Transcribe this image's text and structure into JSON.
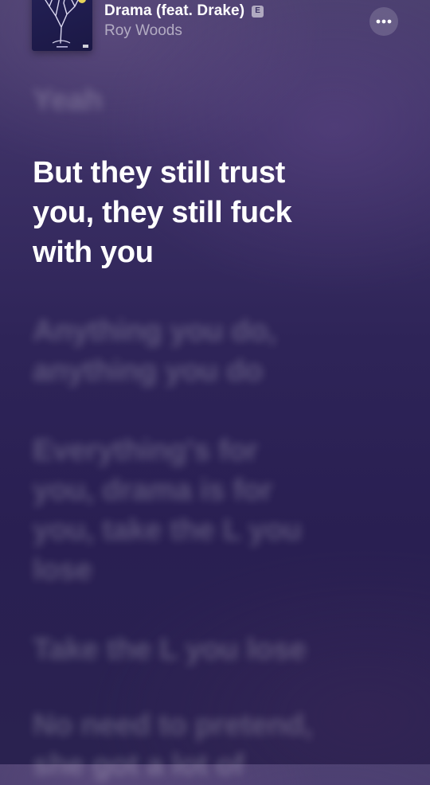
{
  "now_playing": {
    "title": "Drama (feat. Drake)",
    "explicit_badge": "E",
    "artist": "Roy Woods",
    "more_icon": "ellipsis-icon",
    "artwork_icon": "tree-artwork"
  },
  "lyrics": {
    "lines": [
      {
        "text": "Yeah",
        "state": "past"
      },
      {
        "text": "But they still trust\nyou, they still fuck\nwith you",
        "state": "current"
      },
      {
        "text": "Anything you do,\nanything you do",
        "state": "upcoming"
      },
      {
        "text": "Everything's for\nyou, drama is for\nyou, take the L you\nlose",
        "state": "upcoming"
      },
      {
        "text": "Take the L you lose",
        "state": "upcoming"
      },
      {
        "text": "No need to pretend,\nshe got a lot of",
        "state": "upcoming"
      }
    ]
  },
  "colors": {
    "background_top": "#4a3f6e",
    "background_bottom": "#291f52",
    "active_lyric": "#ffffff",
    "inactive_lyric": "rgba(255,255,255,0.22)"
  }
}
